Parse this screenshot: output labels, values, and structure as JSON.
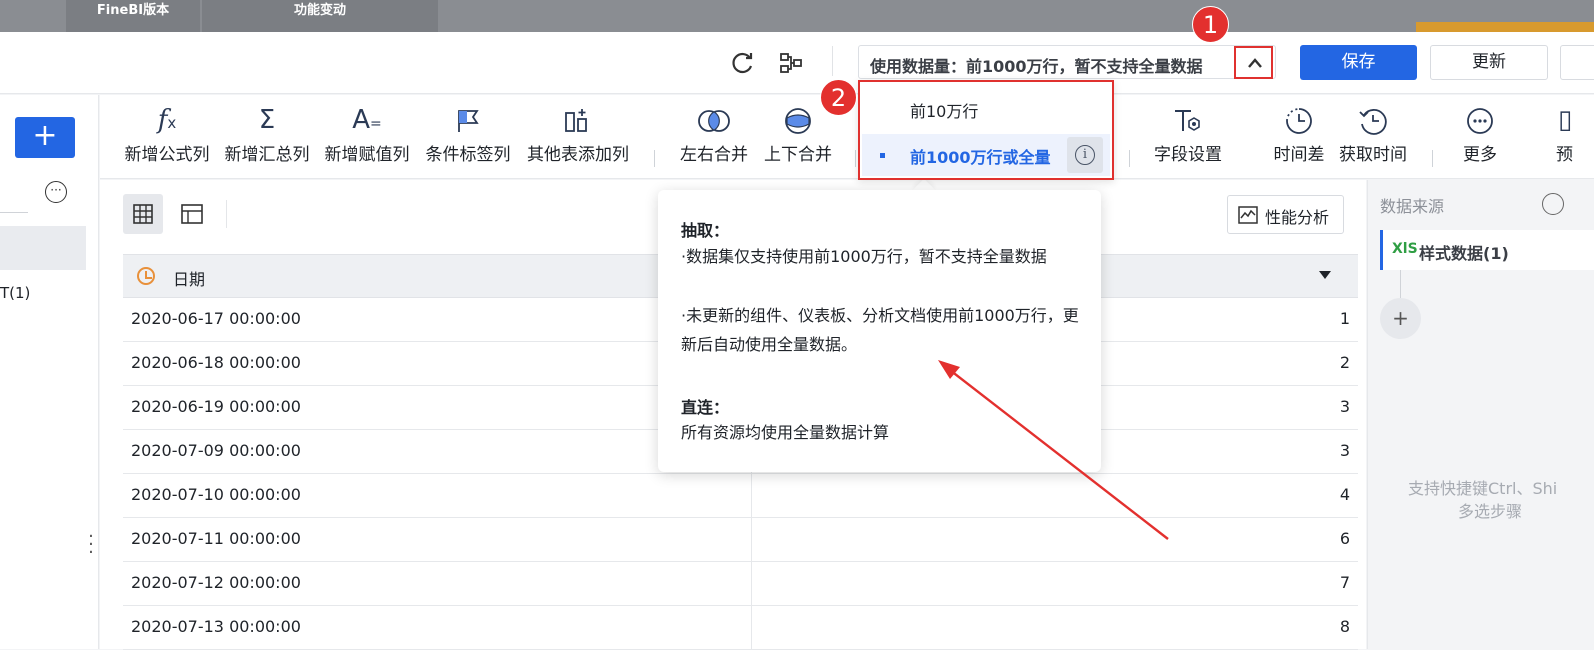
{
  "banner": {
    "tabs": [
      "FineBI版本",
      "功能变动"
    ]
  },
  "header": {
    "data_mode_label": "使用数据量：前1000万行，暂不支持全量数据",
    "save": "保存",
    "update": "更新"
  },
  "left": {
    "add_symbol": "+",
    "item": "T(1)"
  },
  "toolbar": {
    "tools": [
      {
        "label": "新增公式列",
        "icon": "formula-icon"
      },
      {
        "label": "新增汇总列",
        "icon": "sigma-icon"
      },
      {
        "label": "新增赋值列",
        "icon": "assign-icon"
      },
      {
        "label": "条件标签列",
        "icon": "flag-icon"
      },
      {
        "label": "其他表添加列",
        "icon": "add-column-icon"
      },
      {
        "label": "左右合并",
        "icon": "merge-lr-icon"
      },
      {
        "label": "上下合并",
        "icon": "merge-ud-icon"
      },
      {
        "label": "字段设置",
        "icon": "field-settings-icon"
      },
      {
        "label": "时间差",
        "icon": "time-diff-icon"
      },
      {
        "label": "获取时间",
        "icon": "get-time-icon"
      },
      {
        "label": "更多",
        "icon": "more-icon"
      },
      {
        "label": "预",
        "icon": "preview-icon"
      }
    ]
  },
  "main": {
    "perf_button": "性能分析",
    "column_header": "日期",
    "rows": [
      {
        "date": "2020-06-17 00:00:00",
        "value": "1"
      },
      {
        "date": "2020-06-18 00:00:00",
        "value": "2"
      },
      {
        "date": "2020-06-19 00:00:00",
        "value": "3"
      },
      {
        "date": "2020-07-09 00:00:00",
        "value": "3"
      },
      {
        "date": "2020-07-10 00:00:00",
        "value": "4"
      },
      {
        "date": "2020-07-11 00:00:00",
        "value": "6"
      },
      {
        "date": "2020-07-12 00:00:00",
        "value": "7"
      },
      {
        "date": "2020-07-13 00:00:00",
        "value": "8"
      }
    ]
  },
  "right": {
    "title": "数据来源",
    "source_icon": "XlS",
    "source_name": "样式数据(1)",
    "hint_line1": "支持快捷键Ctrl、Shi",
    "hint_line2": "多选步骤"
  },
  "dropdown": {
    "option1": "前10万行",
    "option2": "前1000万行或全量",
    "info_glyph": "i"
  },
  "tooltip": {
    "h1": "抽取：",
    "p1": "·数据集仅支持使用前1000万行，暂不支持全量数据",
    "p2": "·未更新的组件、仪表板、分析文档使用前1000万行，更新后自动使用全量数据。",
    "h2": "直连：",
    "p3": "所有资源均使用全量数据计算"
  },
  "badges": [
    "1",
    "2"
  ],
  "colors": {
    "primary": "#2366e3",
    "annotation_red": "#e3302e"
  }
}
